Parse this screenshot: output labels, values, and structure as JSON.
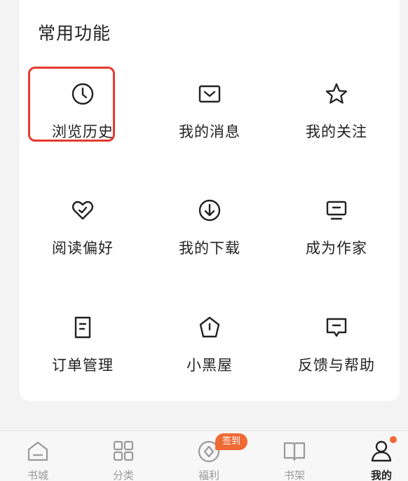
{
  "section_title": "常用功能",
  "functions": [
    {
      "label": "浏览历史",
      "icon": "clock-icon"
    },
    {
      "label": "我的消息",
      "icon": "mail-icon"
    },
    {
      "label": "我的关注",
      "icon": "star-icon"
    },
    {
      "label": "阅读偏好",
      "icon": "heart-check-icon"
    },
    {
      "label": "我的下载",
      "icon": "download-icon"
    },
    {
      "label": "成为作家",
      "icon": "monitor-icon"
    },
    {
      "label": "订单管理",
      "icon": "document-icon"
    },
    {
      "label": "小黑屋",
      "icon": "pentagon-icon"
    },
    {
      "label": "反馈与帮助",
      "icon": "feedback-icon"
    }
  ],
  "highlight_color": "#e53a2f",
  "tabbar": {
    "items": [
      {
        "label": "书城",
        "icon": "home-icon",
        "active": false
      },
      {
        "label": "分类",
        "icon": "grid-icon",
        "active": false
      },
      {
        "label": "福利",
        "icon": "coin-icon",
        "active": false
      },
      {
        "label": "书架",
        "icon": "book-icon",
        "active": false
      },
      {
        "label": "我的",
        "icon": "user-icon",
        "active": true
      }
    ],
    "badge": "签到",
    "badge_color": "#f06a35"
  }
}
